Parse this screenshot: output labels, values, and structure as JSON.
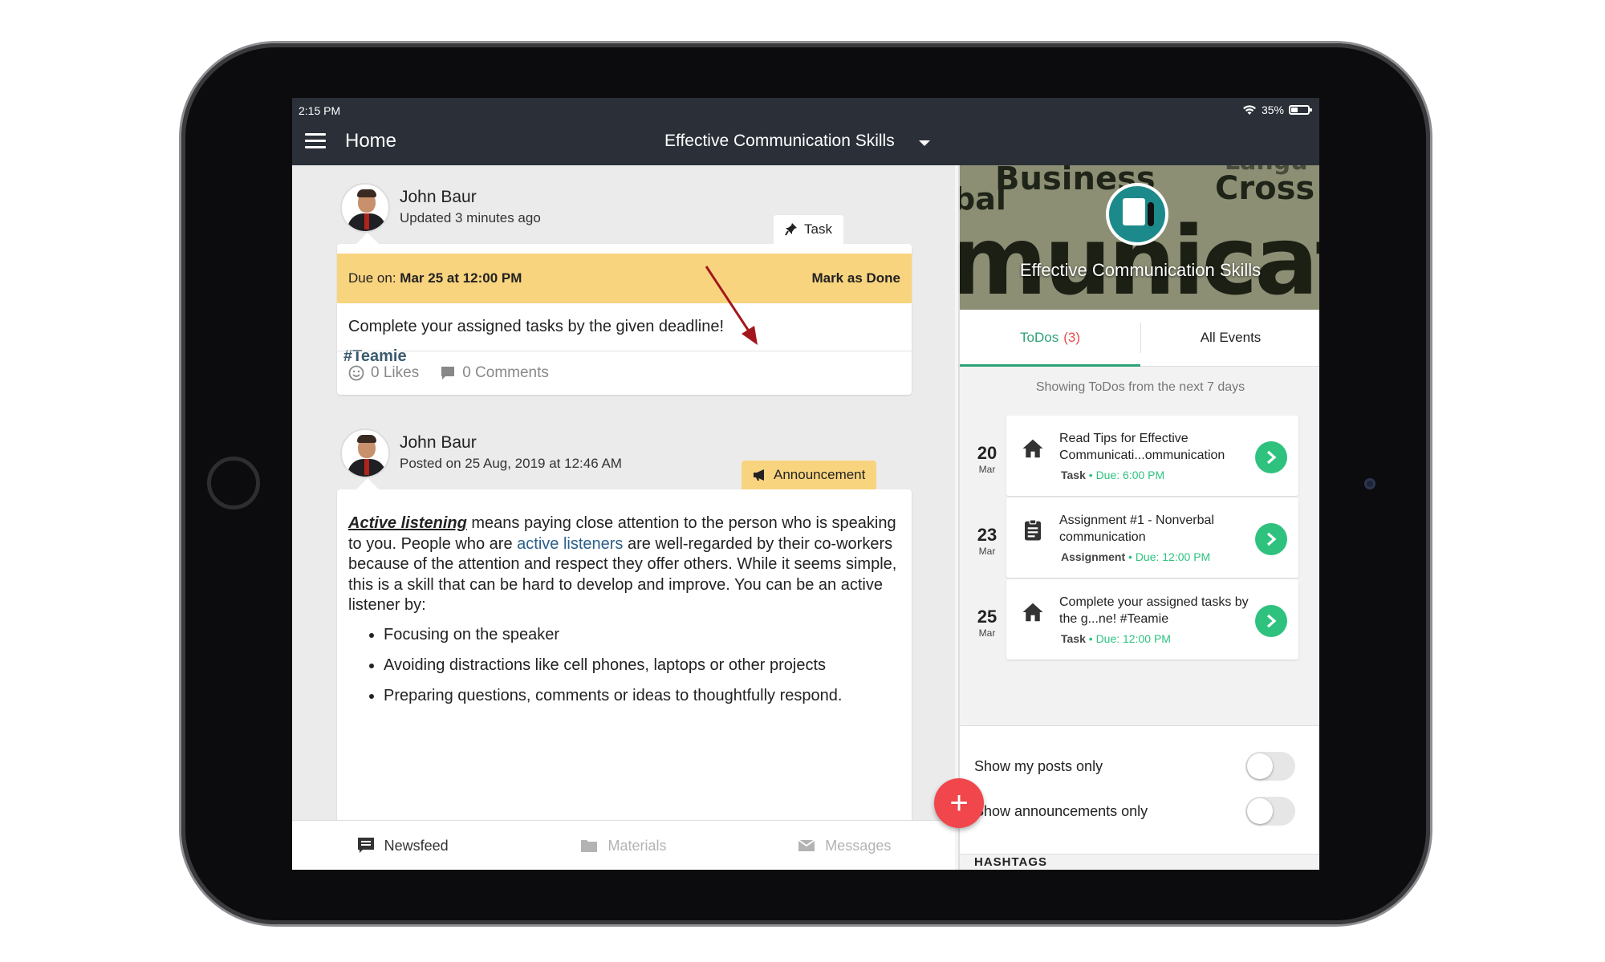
{
  "status": {
    "time": "2:15 PM",
    "battery": "35%",
    "battery_level": 0.35
  },
  "appbar": {
    "title": "Home",
    "course": "Effective Communication Skills"
  },
  "posts": [
    {
      "author": "John Baur",
      "meta": "Updated 3 minutes ago",
      "tag": "Task",
      "due_label": "Due on:",
      "due_value": "Mar 25 at 12:00 PM",
      "action": "Mark as Done",
      "text": "Complete your assigned tasks by the given deadline!",
      "hashtag": "#Teamie",
      "likes": "0 Likes",
      "comments": "0 Comments"
    },
    {
      "author": "John Baur",
      "meta": "Posted on 25 Aug, 2019 at 12:46 AM",
      "tag": "Announcement",
      "lead": "Active listening",
      "body_1": " means paying close attention to the person who is speaking to you. People who are ",
      "link": "active listeners",
      "body_2": " are well-regarded by their co-workers because of the attention and respect they offer others. While it seems simple, this is a skill that can be hard to develop and improve. You can be an active listener by:",
      "bullets": [
        "Focusing on the speaker",
        "Avoiding distractions like cell phones, laptops or other projects",
        "Preparing questions, comments or ideas to thoughtfully respond."
      ]
    }
  ],
  "bottom_nav": [
    {
      "label": "Newsfeed",
      "icon": "newsfeed-icon"
    },
    {
      "label": "Materials",
      "icon": "folder-icon"
    },
    {
      "label": "Messages",
      "icon": "mail-icon"
    }
  ],
  "fab": {
    "icon": "plus-icon",
    "label": "+"
  },
  "panel": {
    "banner_title": "Effective Communication Skills",
    "banner_words": [
      "Business",
      "Cross",
      "Langu",
      "bal",
      "municat"
    ],
    "tabs": [
      {
        "label": "ToDos",
        "count": "(3)"
      },
      {
        "label": "All Events"
      }
    ],
    "caption": "Showing ToDos from the next 7 days",
    "todos": [
      {
        "day": "20",
        "month": "Mar",
        "icon": "home-icon",
        "title": "Read Tips for Effective Communicati...ommunication",
        "type": "Task",
        "due": "Due: 6:00 PM"
      },
      {
        "day": "23",
        "month": "Mar",
        "icon": "clipboard-icon",
        "title": "Assignment #1 - Nonverbal communication",
        "type": "Assignment",
        "due": "Due: 12:00 PM"
      },
      {
        "day": "25",
        "month": "Mar",
        "icon": "home-icon",
        "title": "Complete your assigned tasks by the g...ne!   #Teamie",
        "type": "Task",
        "due": "Due: 12:00 PM"
      }
    ],
    "toggles": [
      {
        "label": "Show my posts only",
        "on": false
      },
      {
        "label": "Show announcements only",
        "on": false
      }
    ],
    "hashtags_header": "HASHTAGS"
  },
  "colors": {
    "accent": "#2ec27e",
    "fab": "#f0464c",
    "due_bar": "#f9d47f",
    "appbar": "#2a2f38",
    "annotation_arrow": "#a3171c"
  }
}
